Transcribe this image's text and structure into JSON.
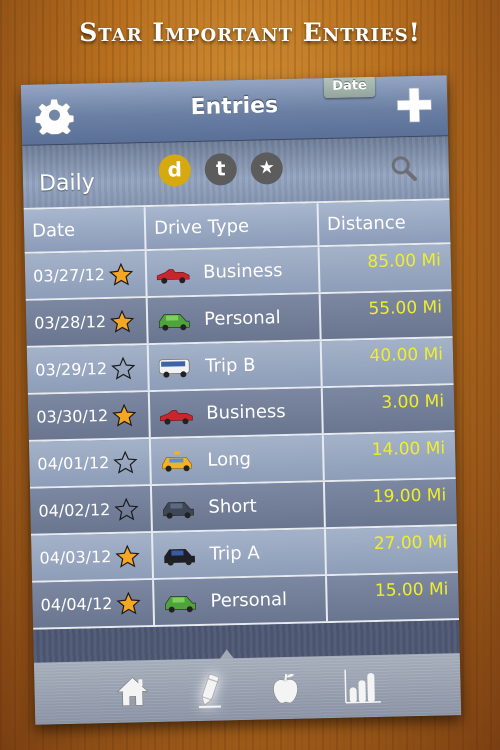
{
  "headline": "Star Important Entries!",
  "navbar": {
    "title": "Entries",
    "date_tab_label": "Date",
    "settings_icon": "gear-icon",
    "add_icon": "plus-icon"
  },
  "filterbar": {
    "period_label": "Daily",
    "filters": [
      {
        "label": "d",
        "active": true,
        "color": "#d6a90e"
      },
      {
        "label": "t",
        "active": false,
        "color": "#5c5c5c"
      },
      {
        "label": "★",
        "active": false,
        "color": "#5c5c5c"
      }
    ],
    "search_icon": "search-icon"
  },
  "table": {
    "headers": [
      "Date",
      "Drive Type",
      "Distance"
    ],
    "rows": [
      {
        "date": "03/27/12",
        "starred": true,
        "vehicle": "red-convertible",
        "type": "Business",
        "distance": "85.00 Mi"
      },
      {
        "date": "03/28/12",
        "starred": true,
        "vehicle": "green-hatchback",
        "type": "Personal",
        "distance": "55.00 Mi"
      },
      {
        "date": "03/29/12",
        "starred": false,
        "vehicle": "white-bus",
        "type": "Trip B",
        "distance": "40.00 Mi"
      },
      {
        "date": "03/30/12",
        "starred": true,
        "vehicle": "red-convertible",
        "type": "Business",
        "distance": "3.00 Mi"
      },
      {
        "date": "04/01/12",
        "starred": false,
        "vehicle": "yellow-taxi",
        "type": "Long",
        "distance": "14.00 Mi"
      },
      {
        "date": "04/02/12",
        "starred": false,
        "vehicle": "dark-suv",
        "type": "Short",
        "distance": "19.00 Mi"
      },
      {
        "date": "04/03/12",
        "starred": true,
        "vehicle": "black-sedan",
        "type": "Trip A",
        "distance": "27.00 Mi"
      },
      {
        "date": "04/04/12",
        "starred": true,
        "vehicle": "green-hatchback",
        "type": "Personal",
        "distance": "15.00 Mi"
      }
    ]
  },
  "tabbar": {
    "tabs": [
      {
        "icon": "home-icon",
        "active": false
      },
      {
        "icon": "pencil-icon",
        "active": true
      },
      {
        "icon": "apple-icon",
        "active": false
      },
      {
        "icon": "bar-chart-icon",
        "active": false
      }
    ]
  },
  "colors": {
    "distance_text": "#f0ee2a",
    "star_filled": "#f5a623",
    "active_filter": "#d6a90e"
  }
}
